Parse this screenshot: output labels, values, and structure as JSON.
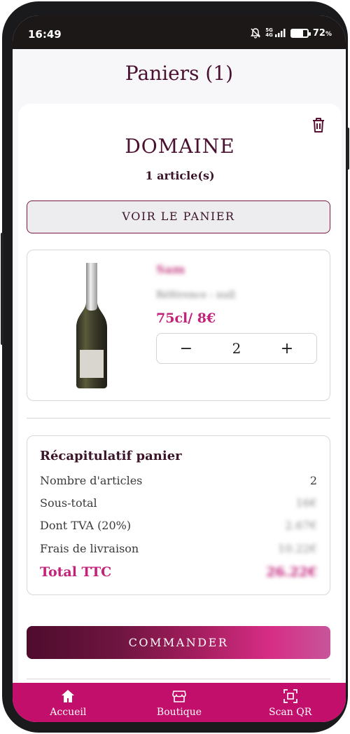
{
  "status_bar": {
    "time": "16:49",
    "battery": "72",
    "battery_unit": "%",
    "network": [
      "5G",
      "4G"
    ],
    "battery_level": 0.72
  },
  "header": {
    "title": "Paniers (1)"
  },
  "cart": {
    "domain": "DOMAINE",
    "article_count": "1 article(s)",
    "view_cart_label": "VOIR LE PANIER"
  },
  "product": {
    "name": "Sam",
    "reference": "Référence : null",
    "price": "75cl/ 8€",
    "quantity": "2",
    "minus": "−",
    "plus": "+"
  },
  "summary": {
    "title": "Récapitulatif panier",
    "rows": [
      {
        "label": "Nombre d'articles",
        "value": "2"
      },
      {
        "label": "Sous-total",
        "value": "16€"
      },
      {
        "label": "Dont TVA (20%)",
        "value": "2.67€"
      },
      {
        "label": "Frais de livraison",
        "value": "10.22€"
      }
    ],
    "total_label": "Total TTC",
    "total_value": "26.22€"
  },
  "order_button": "COMMANDER",
  "nav": [
    {
      "label": "Accueil",
      "icon": "home-icon"
    },
    {
      "label": "Boutique",
      "icon": "shop-icon"
    },
    {
      "label": "Scan QR",
      "icon": "scan-qr-icon"
    }
  ],
  "colors": {
    "accent": "#c2227a",
    "brand_dark": "#4a1030",
    "nav_bg": "#c20f6b"
  }
}
